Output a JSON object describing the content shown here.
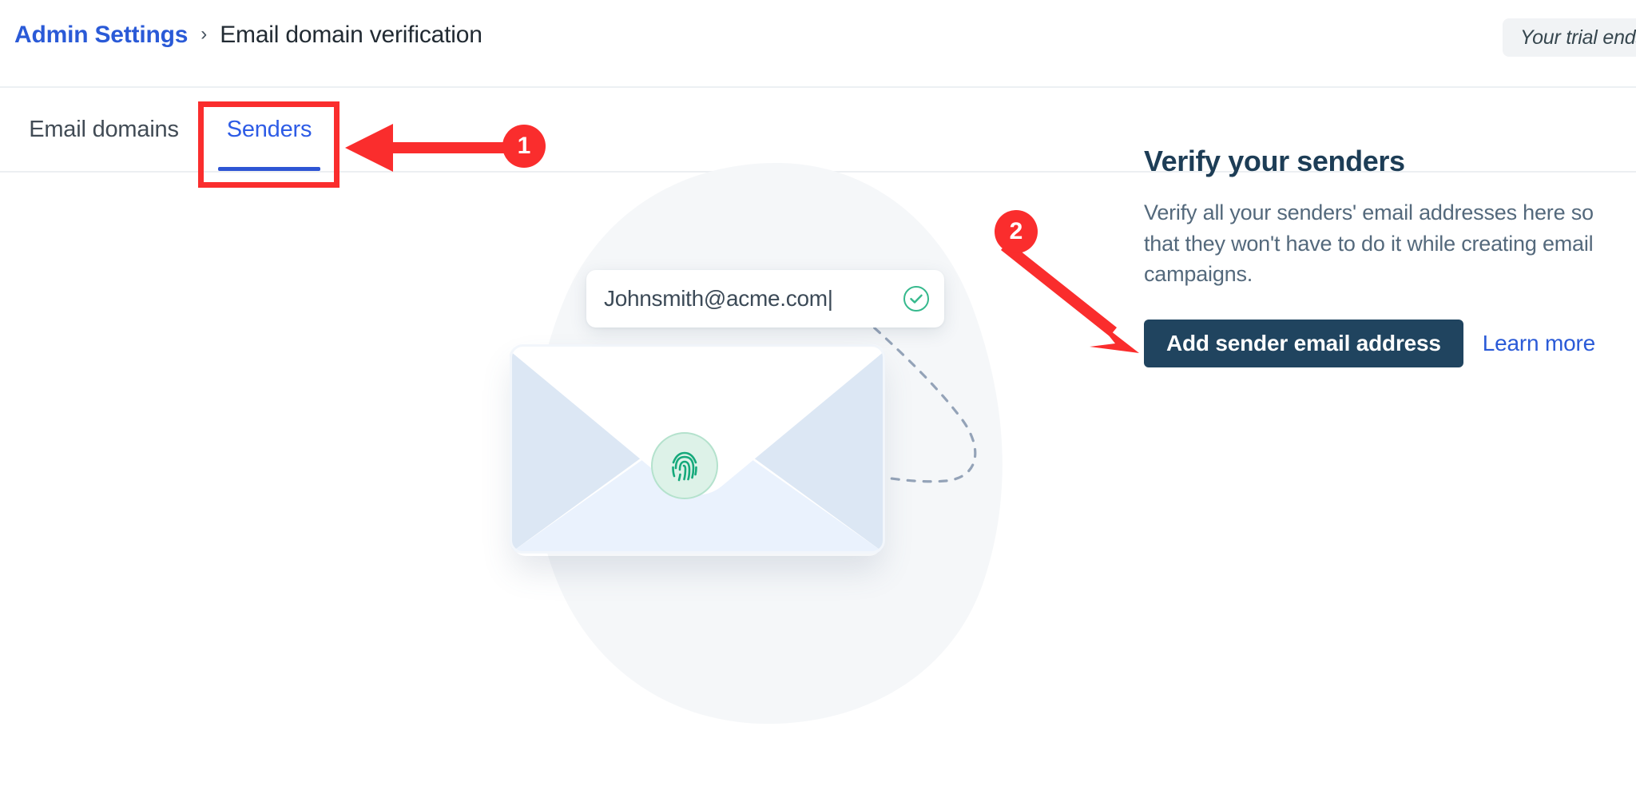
{
  "header": {
    "breadcrumb": {
      "root_label": "Admin Settings",
      "separator": "›",
      "current_label": "Email domain verification"
    },
    "trial_badge": "Your trial ends"
  },
  "tabs": [
    {
      "label": "Email domains",
      "active": false
    },
    {
      "label": "Senders",
      "active": true
    }
  ],
  "illustration": {
    "email_input_value": "Johnsmith@acme.com|",
    "check_icon": "check-circle-icon",
    "fingerprint_icon": "fingerprint-icon",
    "envelope_icon": "envelope-icon"
  },
  "panel": {
    "title": "Verify your senders",
    "description": "Verify all your senders' email addresses here so that they won't have to do it while creating email campaigns.",
    "primary_button": "Add sender email address",
    "learn_more": "Learn more"
  },
  "annotations": [
    {
      "number": "1",
      "target": "Senders tab"
    },
    {
      "number": "2",
      "target": "Add sender email address button"
    }
  ],
  "colors": {
    "accent_blue": "#2a5ad7",
    "tab_active_blue": "#2e5ce6",
    "button_navy": "#20445f",
    "annotation_red": "#fa2d2d",
    "verified_green": "#1aa97a",
    "title_navy": "#1d3d56"
  }
}
